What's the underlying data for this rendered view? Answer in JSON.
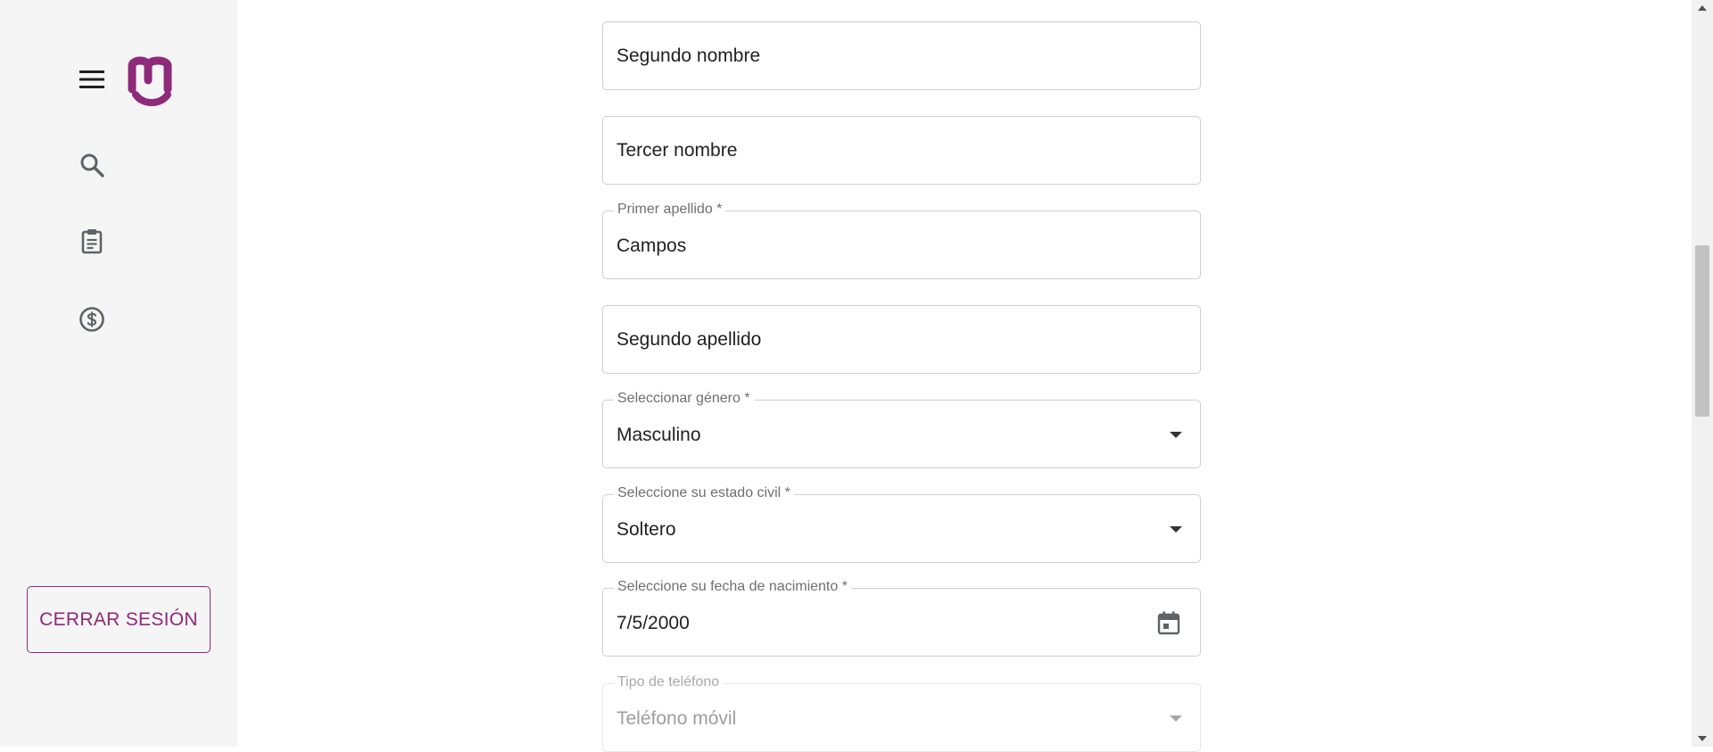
{
  "colors": {
    "accent": "#8e2a79",
    "sidebar_bg": "#f5f5f5",
    "border": "#cfcfcf"
  },
  "sidebar": {
    "menu_icon": "menu-icon",
    "logo": "brand-logo",
    "nav_items": [
      {
        "icon": "search-icon"
      },
      {
        "icon": "clipboard-icon"
      },
      {
        "icon": "dollar-circle-icon"
      }
    ],
    "logout_label": "CERRAR SESIÓN"
  },
  "form": {
    "segundo_nombre": {
      "label": "",
      "placeholder": "Segundo nombre",
      "value": ""
    },
    "tercer_nombre": {
      "label": "",
      "placeholder": "Tercer nombre",
      "value": ""
    },
    "primer_apellido": {
      "label": "Primer apellido *",
      "value": "Campos"
    },
    "segundo_apellido": {
      "label": "",
      "placeholder": "Segundo apellido",
      "value": ""
    },
    "genero": {
      "label": "Seleccionar género *",
      "value": "Masculino"
    },
    "estado_civil": {
      "label": "Seleccione su estado civil *",
      "value": "Soltero"
    },
    "fecha_nacimiento": {
      "label": "Seleccione su fecha de nacimiento *",
      "value": "7/5/2000",
      "icon": "calendar-icon"
    },
    "tipo_telefono": {
      "label": "Tipo de teléfono",
      "value": "Teléfono móvil"
    }
  }
}
